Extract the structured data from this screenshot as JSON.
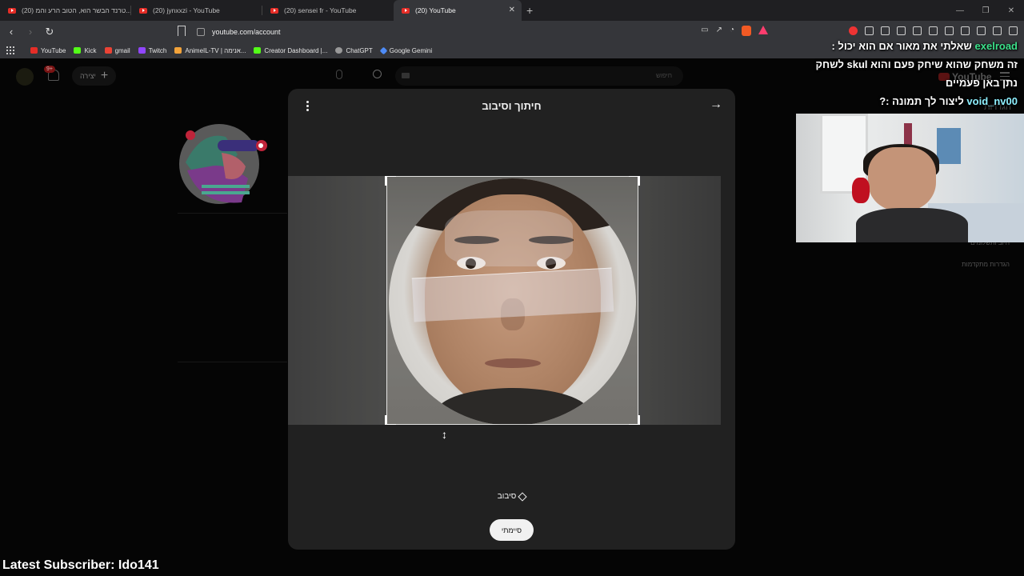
{
  "browser": {
    "tabs": [
      {
        "label": "(20) טרנד הבשר הוא, הטוב הרע והמ...",
        "active": false
      },
      {
        "label": "(20) jynxxzi - YouTube",
        "active": false
      },
      {
        "label": "(20) sensei fr - YouTube",
        "active": false
      },
      {
        "label": "(20) YouTube",
        "active": true
      }
    ],
    "url": "youtube.com/account",
    "bookmarks": [
      {
        "label": "YouTube",
        "color": "#e52d27"
      },
      {
        "label": "Kick",
        "color": "#53fc18"
      },
      {
        "label": "gmail",
        "color": "#ea4335"
      },
      {
        "label": "Twitch",
        "color": "#9146ff"
      },
      {
        "label": "AnimeIL-TV | אנימה...",
        "color": "#f2a33a"
      },
      {
        "label": "Creator Dashboard |...",
        "color": "#53fc18"
      },
      {
        "label": "ChatGPT",
        "color": "#999999"
      },
      {
        "label": "Google Gemini",
        "color": "#4e8cf7"
      }
    ]
  },
  "youtube": {
    "create_label": "יצירה",
    "notification_count": "9+",
    "search_placeholder": "חיפוש",
    "logo_text": "YouTube",
    "sidebar_title": "הגדרות",
    "sidebar_links": [
      "חיוב ותשלומים",
      "הגדרות מתקדמות"
    ]
  },
  "dialog": {
    "title": "חיתוך וסיבוב",
    "rotate_label": "סיבוב",
    "done_label": "סיימתי"
  },
  "stream": {
    "chat": [
      {
        "user": "exelroad",
        "message": "שאלתי את מאור אם הוא יכול :"
      },
      {
        "user": "",
        "message": "זה משחק שהוא שיחק פעם והוא skul לשחק"
      },
      {
        "user": "",
        "message": "נתן באן פעמיים"
      },
      {
        "user": "void_nv00",
        "message": "ליצור לך תמונה :"
      }
    ],
    "subscriber_text": "Latest Subscriber: Ido141"
  }
}
